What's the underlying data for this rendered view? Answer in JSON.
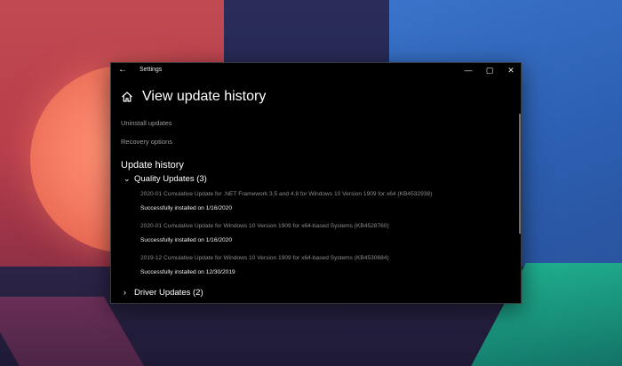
{
  "window": {
    "title": "Settings",
    "controls": {
      "minimize": "—",
      "maximize": "▢",
      "close": "✕"
    },
    "back_glyph": "←"
  },
  "page": {
    "title": "View update history",
    "icon": "home-icon"
  },
  "links": {
    "uninstall": "Uninstall updates",
    "recovery": "Recovery options"
  },
  "history": {
    "heading": "Update history",
    "groups": [
      {
        "label": "Quality Updates (3)",
        "expanded": true,
        "items": [
          {
            "name": "2020-01 Cumulative Update for .NET Framework 3.5 and 4.8 for Windows 10 Version 1909 for x64 (KB4532938)",
            "status": "Successfully installed on 1/16/2020"
          },
          {
            "name": "2020-01 Cumulative Update for Windows 10 Version 1909 for x64-based Systems (KB4528760)",
            "status": "Successfully installed on 1/16/2020"
          },
          {
            "name": "2019-12 Cumulative Update for Windows 10 Version 1909 for x64-based Systems (KB4530684)",
            "status": "Successfully installed on 12/30/2019"
          }
        ]
      },
      {
        "label": "Driver Updates (2)",
        "expanded": false,
        "items": []
      }
    ]
  },
  "colors": {
    "window_bg": "#000000",
    "link_gray": "#9a9a9a",
    "item_name_gray": "#8c8c8c",
    "text_white": "#ffffff"
  }
}
